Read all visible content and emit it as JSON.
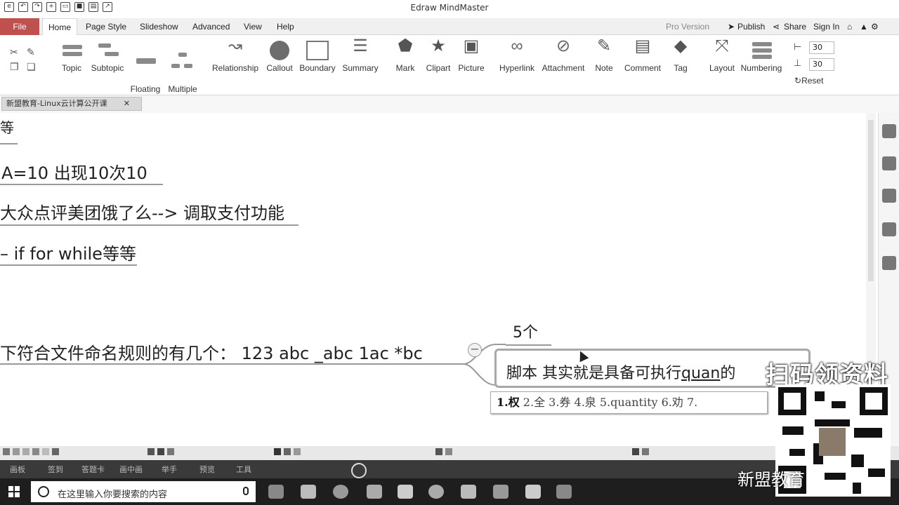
{
  "app": {
    "title": "Edraw MindMaster"
  },
  "menu": {
    "file": "File",
    "tabs": [
      "Home",
      "Page Style",
      "Slideshow",
      "Advanced",
      "View",
      "Help"
    ],
    "right": {
      "pro": "Pro Version",
      "publish": "Publish",
      "share": "Share",
      "signin": "Sign In"
    }
  },
  "ribbon": {
    "buttons": [
      {
        "label": "Topic"
      },
      {
        "label": "Subtopic"
      },
      {
        "label": "Floating\nTopic"
      },
      {
        "label": "Multiple\nTopics"
      },
      {
        "label": "Relationship"
      },
      {
        "label": "Callout"
      },
      {
        "label": "Boundary"
      },
      {
        "label": "Summary"
      },
      {
        "label": "Mark"
      },
      {
        "label": "Clipart"
      },
      {
        "label": "Picture"
      },
      {
        "label": "Hyperlink"
      },
      {
        "label": "Attachment"
      },
      {
        "label": "Note"
      },
      {
        "label": "Comment"
      },
      {
        "label": "Tag"
      },
      {
        "label": "Layout"
      },
      {
        "label": "Numbering"
      }
    ],
    "spin_h": "30",
    "spin_v": "30",
    "reset": "Reset"
  },
  "doc_tab": {
    "title": "新盟教育-Linux云计算公开课"
  },
  "canvas": {
    "partial_top": "等",
    "line1": "A=10  出现10次10",
    "line2": "大众点评美团饿了么--> 调取支付功能",
    "line3": "– if for while等等",
    "question": "下符合文件命名规则的有几个：   123  abc  _abc  1ac  *bc",
    "answer": "5个",
    "edit_prefix": "脚本 其实就是具备可执行",
    "edit_typed": "quan",
    "edit_suffix": "的",
    "ime_first": "1.权",
    "ime_rest": " 2.全 3.券 4.泉 5.quantity 6.劝 7."
  },
  "bottom_bar": {
    "labels": [
      "画板",
      "签到",
      "答题卡",
      "画中画",
      "举手",
      "预览",
      "工具"
    ]
  },
  "taskbar": {
    "search_placeholder": "在这里输入你要搜索的内容"
  },
  "watermark": {
    "title": "扫码领资料",
    "bottom": "新盟教育"
  }
}
